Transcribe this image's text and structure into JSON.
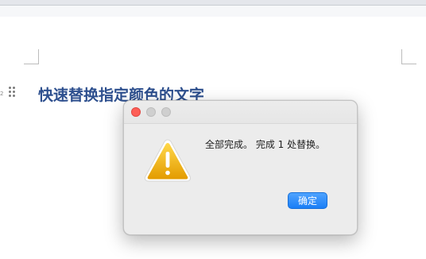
{
  "document": {
    "paragraph_mark": "2",
    "heading": "快速替换指定颜色的文字"
  },
  "dialog": {
    "icon": "warning-triangle-icon",
    "message": "全部完成。 完成 1 处替换。",
    "ok_label": "确定"
  },
  "colors": {
    "heading": "#2d4f8e",
    "accent": "#1a7ef6",
    "close": "#fd5e56",
    "warning": "#f2b705"
  }
}
